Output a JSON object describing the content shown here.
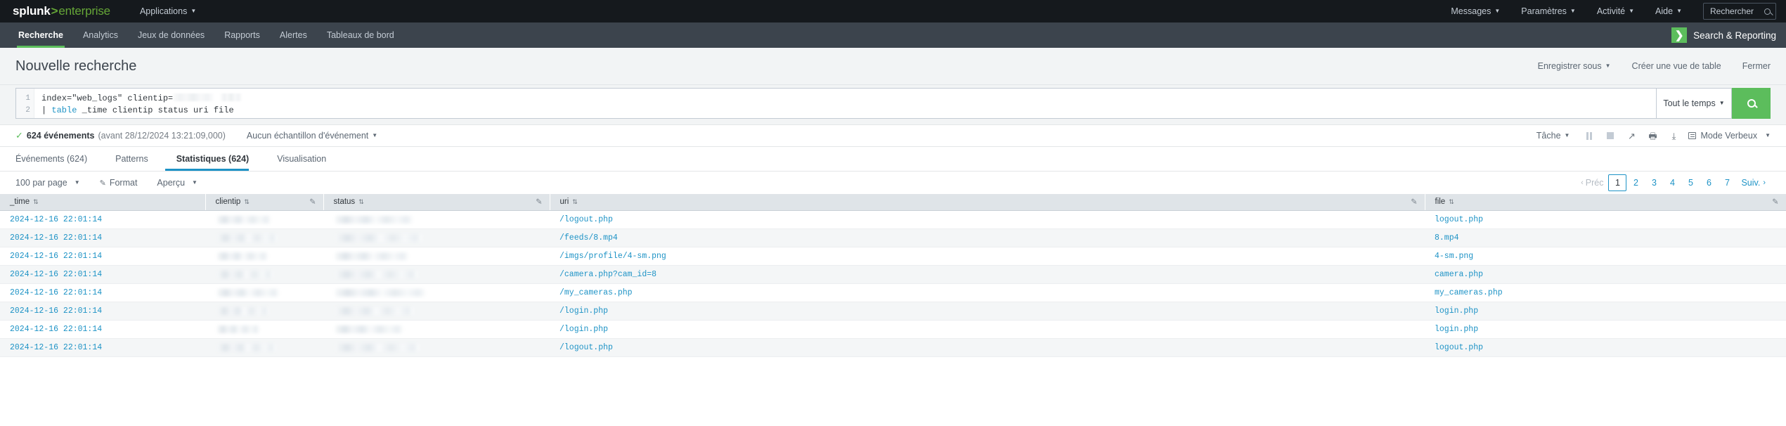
{
  "topbar": {
    "logo": {
      "splunk": "splunk",
      "gt": ">",
      "enterprise": "enterprise"
    },
    "left_nav": [
      {
        "label": "Applications",
        "caret": true
      }
    ],
    "right_nav": [
      {
        "label": "Messages",
        "caret": true
      },
      {
        "label": "Paramètres",
        "caret": true
      },
      {
        "label": "Activité",
        "caret": true
      },
      {
        "label": "Aide",
        "caret": true
      }
    ],
    "search": {
      "placeholder": "Rechercher",
      "icon": "search-icon"
    }
  },
  "appbar": {
    "tabs": [
      {
        "label": "Recherche",
        "active": true
      },
      {
        "label": "Analytics",
        "active": false
      },
      {
        "label": "Jeux de données",
        "active": false
      },
      {
        "label": "Rapports",
        "active": false
      },
      {
        "label": "Alertes",
        "active": false
      },
      {
        "label": "Tableaux de bord",
        "active": false
      }
    ],
    "app": {
      "name": "Search & Reporting",
      "badge_glyph": "❯",
      "badge_color": "#5cbd5c"
    }
  },
  "page_header": {
    "title": "Nouvelle recherche",
    "actions": [
      {
        "label": "Enregistrer sous",
        "caret": true
      },
      {
        "label": "Créer une vue de table",
        "caret": false
      },
      {
        "label": "Fermer",
        "caret": false
      }
    ]
  },
  "search_bar": {
    "lines": [
      "1",
      "2"
    ],
    "line1_prefix": "index=\"web_logs\" clientip=",
    "line1_redacted": true,
    "line2_pipe": "| ",
    "line2_keyword": "table",
    "line2_rest": " _time clientip status uri file",
    "time_picker": {
      "label": "Tout le temps",
      "caret": true
    },
    "submit": {
      "icon": "search-icon",
      "color": "#5cbd5c"
    }
  },
  "info_bar": {
    "check": "✓",
    "event_count": "624 événements",
    "event_range": "(avant 28/12/2024 13:21:09,000)",
    "sampling": "Aucun échantillon d'événement",
    "job_label": "Tâche",
    "controls": [
      {
        "name": "pause-button",
        "glyph": "||"
      },
      {
        "name": "stop-button",
        "glyph": "■"
      },
      {
        "name": "share-button",
        "glyph": "↗"
      },
      {
        "name": "print-button",
        "glyph": "🖶"
      },
      {
        "name": "export-button",
        "glyph": "↓"
      }
    ],
    "verbose_mode": "Mode Verbeux"
  },
  "result_tabs": [
    {
      "label": "Événements (624)",
      "active": false
    },
    {
      "label": "Patterns",
      "active": false
    },
    {
      "label": "Statistiques (624)",
      "active": true
    },
    {
      "label": "Visualisation",
      "active": false
    }
  ],
  "table_toolbar": {
    "per_page": "100 par page",
    "format": "Format",
    "preview": "Aperçu",
    "pagination": {
      "prev": "Préc",
      "next": "Suiv.",
      "pages": [
        "1",
        "2",
        "3",
        "4",
        "5",
        "6",
        "7"
      ],
      "current": "1"
    }
  },
  "table": {
    "columns": [
      {
        "key": "_time",
        "label": "_time",
        "sortable": true,
        "editable": false
      },
      {
        "key": "clientip",
        "label": "clientip",
        "sortable": true,
        "editable": true
      },
      {
        "key": "status",
        "label": "status",
        "sortable": true,
        "editable": true
      },
      {
        "key": "uri",
        "label": "uri",
        "sortable": true,
        "editable": true
      },
      {
        "key": "file",
        "label": "file",
        "sortable": true,
        "editable": true
      }
    ],
    "rows": [
      {
        "_time": "2024-12-16 22:01:14",
        "clientip": "",
        "clientip_redacted": true,
        "status": "",
        "status_redacted": true,
        "uri": "/logout.php",
        "file": "logout.php"
      },
      {
        "_time": "2024-12-16 22:01:14",
        "clientip": "",
        "clientip_redacted": true,
        "status": "",
        "status_redacted": true,
        "uri": "/feeds/8.mp4",
        "file": "8.mp4"
      },
      {
        "_time": "2024-12-16 22:01:14",
        "clientip": "",
        "clientip_redacted": true,
        "status": "",
        "status_redacted": true,
        "uri": "/imgs/profile/4-sm.png",
        "file": "4-sm.png"
      },
      {
        "_time": "2024-12-16 22:01:14",
        "clientip": "",
        "clientip_redacted": true,
        "status": "",
        "status_redacted": true,
        "uri": "/camera.php?cam_id=8",
        "file": "camera.php"
      },
      {
        "_time": "2024-12-16 22:01:14",
        "clientip": "",
        "clientip_redacted": true,
        "status": "",
        "status_redacted": true,
        "uri": "/my_cameras.php",
        "file": "my_cameras.php"
      },
      {
        "_time": "2024-12-16 22:01:14",
        "clientip": "",
        "clientip_redacted": true,
        "status": "",
        "status_redacted": true,
        "uri": "/login.php",
        "file": "login.php"
      },
      {
        "_time": "2024-12-16 22:01:14",
        "clientip": "",
        "clientip_redacted": true,
        "status": "",
        "status_redacted": true,
        "uri": "/login.php",
        "file": "login.php"
      },
      {
        "_time": "2024-12-16 22:01:14",
        "clientip": "",
        "clientip_redacted": true,
        "status": "",
        "status_redacted": true,
        "uri": "/logout.php",
        "file": "logout.php"
      }
    ]
  },
  "colors": {
    "brand_green": "#5cbd5c",
    "topbar_bg": "#15191d",
    "appbar_bg": "#3c444d",
    "link_blue": "#1e93c6",
    "header_bg": "#dfe4e8"
  }
}
